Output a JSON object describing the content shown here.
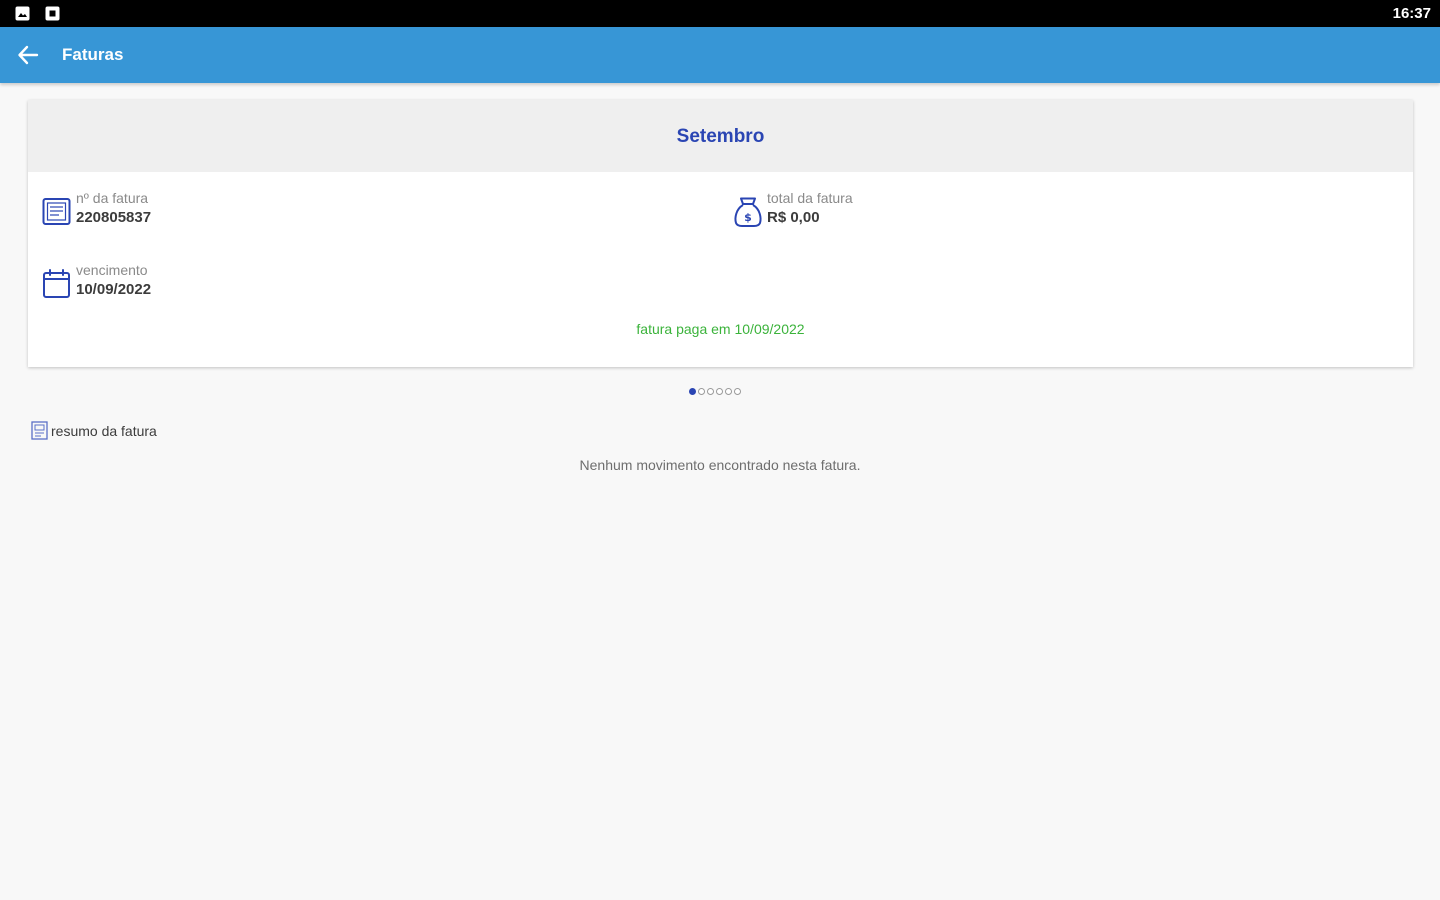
{
  "status_bar": {
    "time": "16:37",
    "icons": [
      "image-notification-icon",
      "app-notification-icon"
    ]
  },
  "app_bar": {
    "title": "Faturas",
    "back_icon": "arrow-left-icon"
  },
  "invoice_card": {
    "month": "Setembro",
    "number_label": "nº da fatura",
    "number_value": "220805837",
    "total_label": "total da fatura",
    "total_value": "R$ 0,00",
    "due_label": "vencimento",
    "due_value": "10/09/2022",
    "paid_message": "fatura paga em 10/09/2022",
    "icons": {
      "number": "invoice-document-icon",
      "total": "money-bag-icon",
      "due": "calendar-icon"
    }
  },
  "pager": {
    "count": 6,
    "active": 0
  },
  "summary": {
    "label": "resumo da fatura",
    "icon": "summary-document-icon"
  },
  "empty_message": "Nenhum movimento encontrado nesta fatura.",
  "colors": {
    "app_bar": "#3796d6",
    "status_bar": "#000000",
    "accent_blue": "#2a45b3",
    "paid_green": "#3bb33b",
    "background": "#f8f8f8",
    "card_header": "#efefef"
  }
}
